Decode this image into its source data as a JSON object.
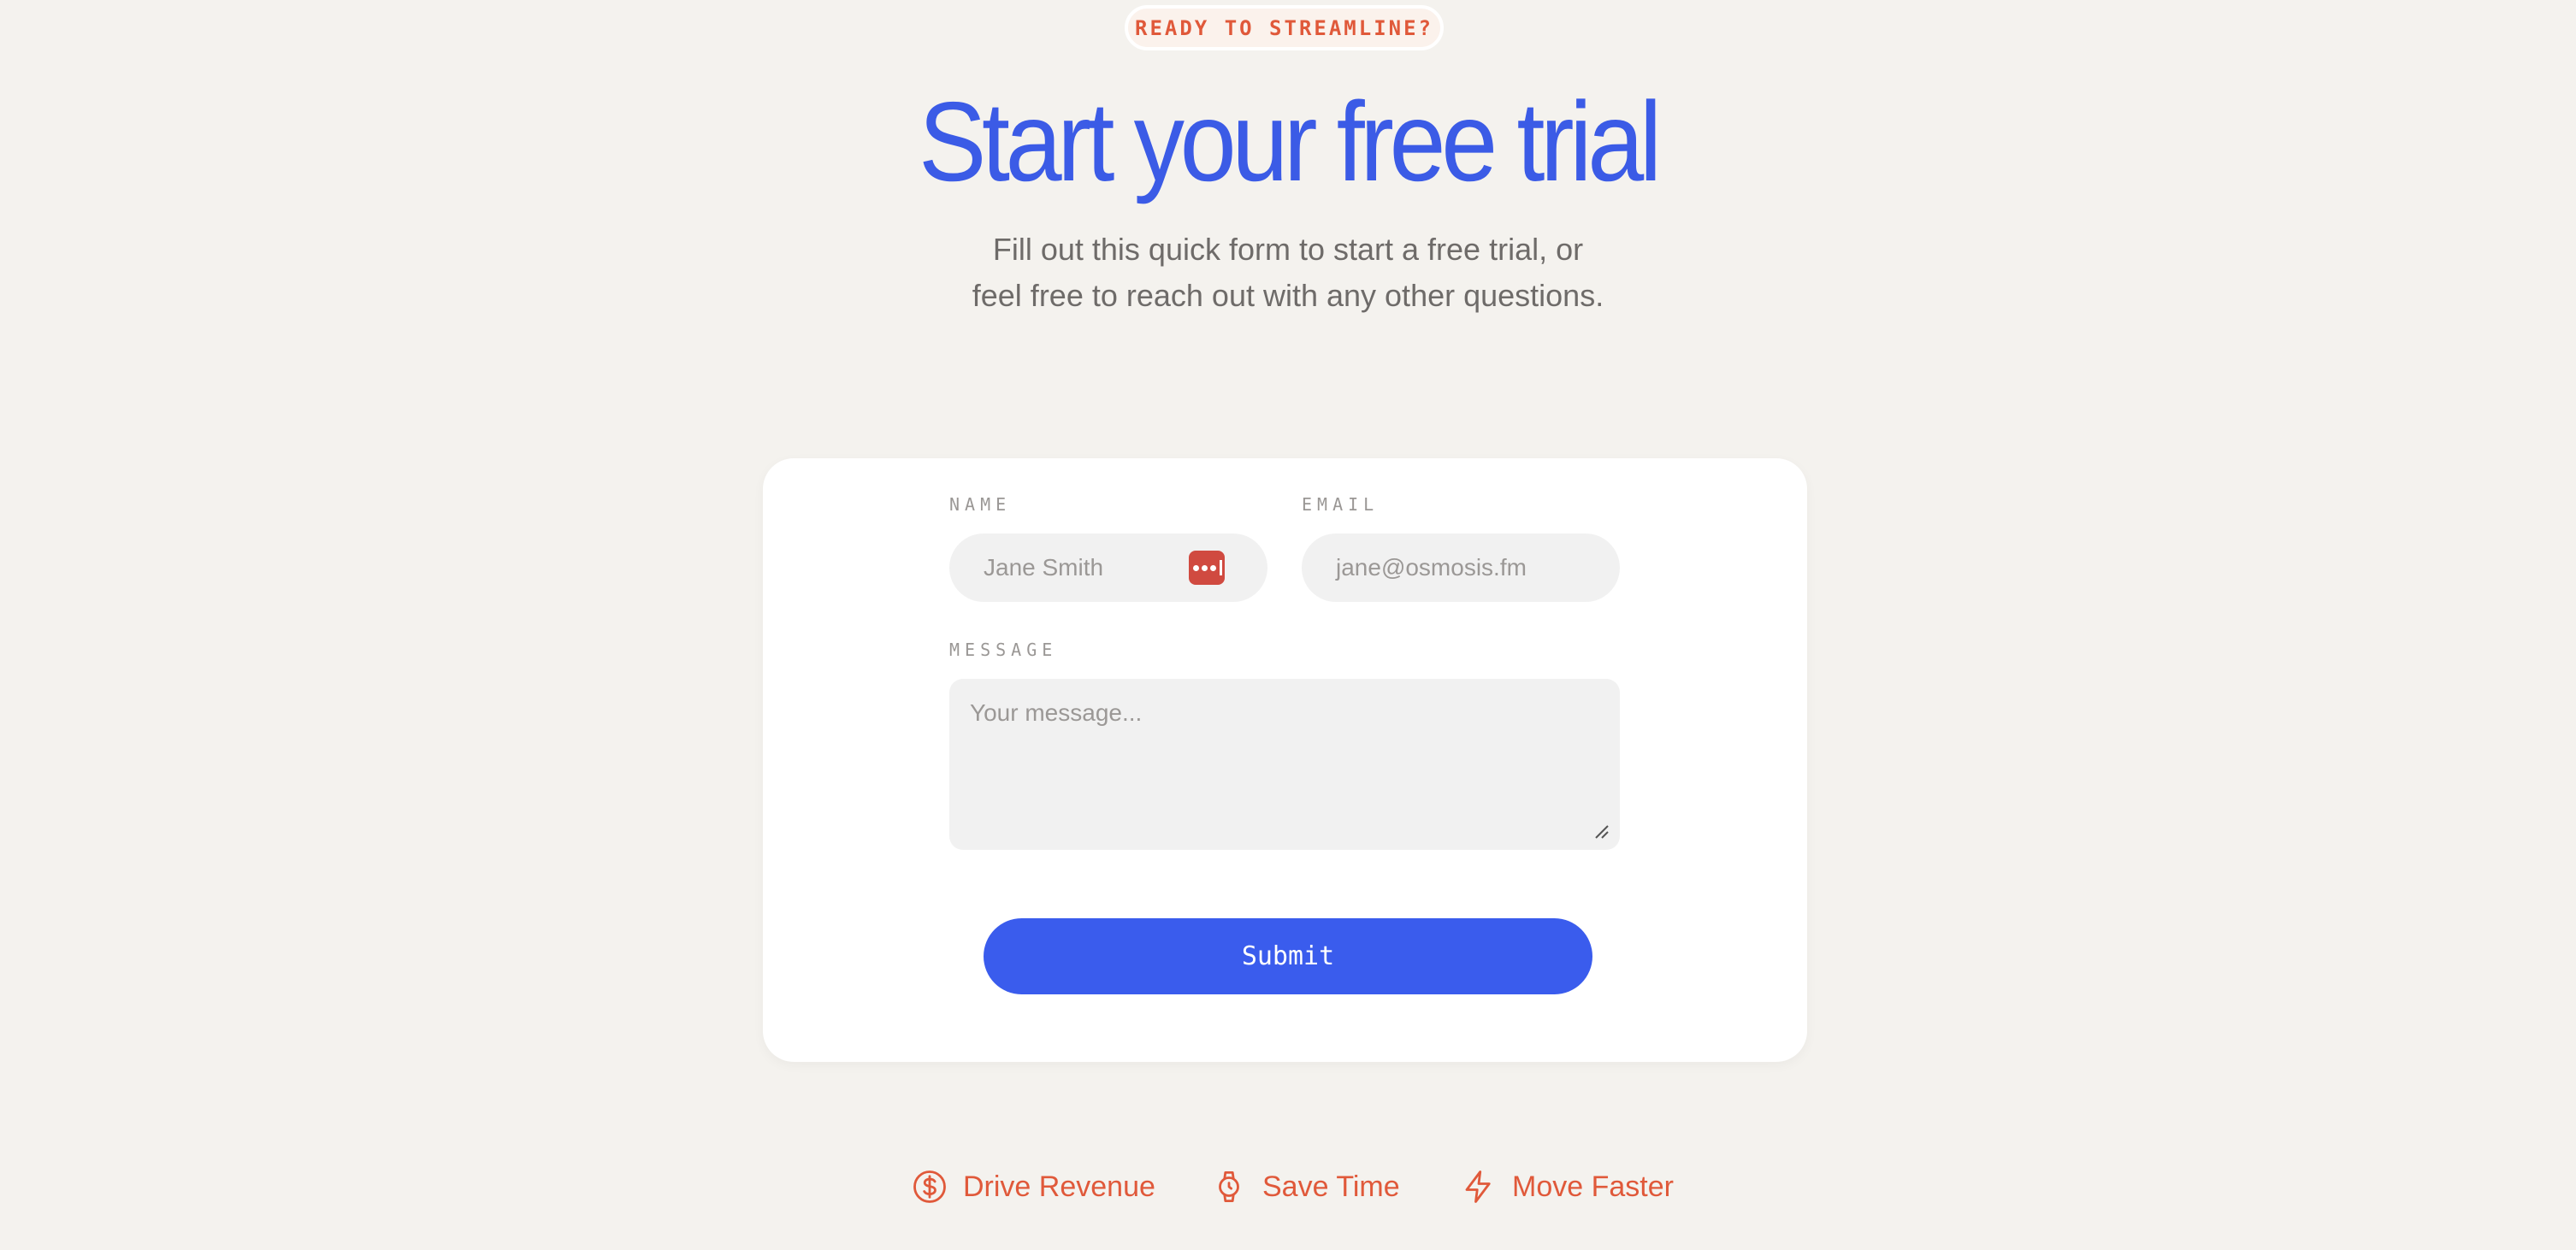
{
  "badge": {
    "text": "READY TO STREAMLINE?"
  },
  "hero": {
    "title": "Start your free trial",
    "subtitle_line1": "Fill out this quick form to start a free trial, or",
    "subtitle_line2": "feel free to reach out with any other questions."
  },
  "form": {
    "name_label": "NAME",
    "name_placeholder": "Jane Smith",
    "email_label": "EMAIL",
    "email_placeholder": "jane@osmosis.fm",
    "message_label": "MESSAGE",
    "message_placeholder": "Your message...",
    "submit_label": "Submit"
  },
  "features": [
    {
      "icon": "dollar-circle-icon",
      "label": "Drive Revenue"
    },
    {
      "icon": "watch-icon",
      "label": "Save Time"
    },
    {
      "icon": "lightning-icon",
      "label": "Move Faster"
    }
  ],
  "colors": {
    "background": "#f4f2ee",
    "accent_blue": "#3a5ced",
    "accent_orange": "#e0593a",
    "card": "#ffffff",
    "input_bg": "#f1f1f1",
    "password_manager_icon": "#d04a40"
  }
}
